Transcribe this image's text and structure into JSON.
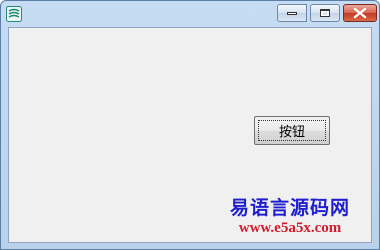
{
  "window": {
    "caption_buttons": {
      "minimize_icon": "minimize-icon",
      "maximize_icon": "maximize-icon",
      "close_icon": "close-icon"
    },
    "app_icon": "app-icon"
  },
  "form": {
    "button_label": "按钮"
  },
  "watermark": {
    "line1": "易语言源码网",
    "line2": "www.e5a5x.com"
  },
  "colors": {
    "titlebar": "#c6dcf2",
    "client": "#f0f0f0",
    "close_button": "#c23a22",
    "watermark_blue": "#1f1fd0",
    "watermark_red": "#d01c2c"
  }
}
